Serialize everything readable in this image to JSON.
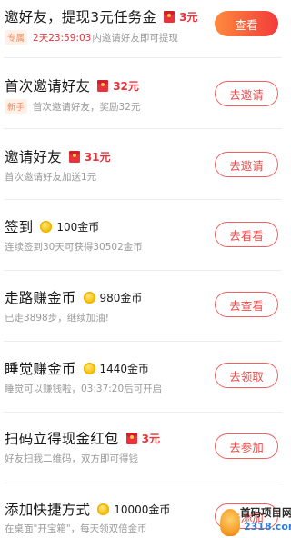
{
  "tasks": [
    {
      "title": "邀好友，提现3元任务金",
      "reward_type": "cash",
      "reward_icon": "red-packet-icon",
      "reward": "3元",
      "tag": "专属",
      "countdown": "2天23:59:03",
      "desc": "内邀请好友即可提现",
      "button": "查看",
      "button_style": "filled"
    },
    {
      "title": "首次邀请好友",
      "reward_type": "cash",
      "reward_icon": "red-packet-icon",
      "reward": "32元",
      "tag": "新手",
      "desc": "首次邀请好友，奖励32元",
      "button": "去邀请",
      "button_style": "outline"
    },
    {
      "title": "邀请好友",
      "reward_type": "cash",
      "reward_icon": "red-packet-icon",
      "reward": "31元",
      "desc": "首次邀请好友加送1元",
      "button": "去邀请",
      "button_style": "outline"
    },
    {
      "title": "签到",
      "reward_type": "coin",
      "reward_icon": "gold-coin-icon",
      "reward": "100金币",
      "desc": "连续签到30天可获得30502金币",
      "button": "去看看",
      "button_style": "outline"
    },
    {
      "title": "走路赚金币",
      "reward_type": "coin",
      "reward_icon": "gold-coin-icon",
      "reward": "980金币",
      "desc": "已走3898步，继续加油!",
      "button": "去查看",
      "button_style": "outline"
    },
    {
      "title": "睡觉赚金币",
      "reward_type": "coin",
      "reward_icon": "gold-coin-icon",
      "reward": "1440金币",
      "desc": "睡觉可以赚钱啦，03:37:20后可开启",
      "button": "去领取",
      "button_style": "outline"
    },
    {
      "title": "扫码立得现金红包",
      "reward_type": "cash",
      "reward_icon": "red-packet-icon",
      "reward": "3元",
      "desc": "好友扫我二维码，双方即可得钱",
      "button": "去参加",
      "button_style": "outline"
    },
    {
      "title": "添加快捷方式",
      "reward_type": "coin",
      "reward_icon": "gold-coin-icon",
      "reward": "10000金币",
      "desc": "在桌面\"开宝箱\"，每天领双倍金币",
      "button": "去添加",
      "button_style": "outline"
    }
  ],
  "watermark": {
    "line1": "首码项目网",
    "line2": "2318.com"
  },
  "colors": {
    "accent_red": "#e8323c",
    "button_gradient_start": "#ff8a3d",
    "button_gradient_end": "#f23b3b",
    "tag_orange": "#f08a5d",
    "muted_text": "#9a9a9a"
  }
}
